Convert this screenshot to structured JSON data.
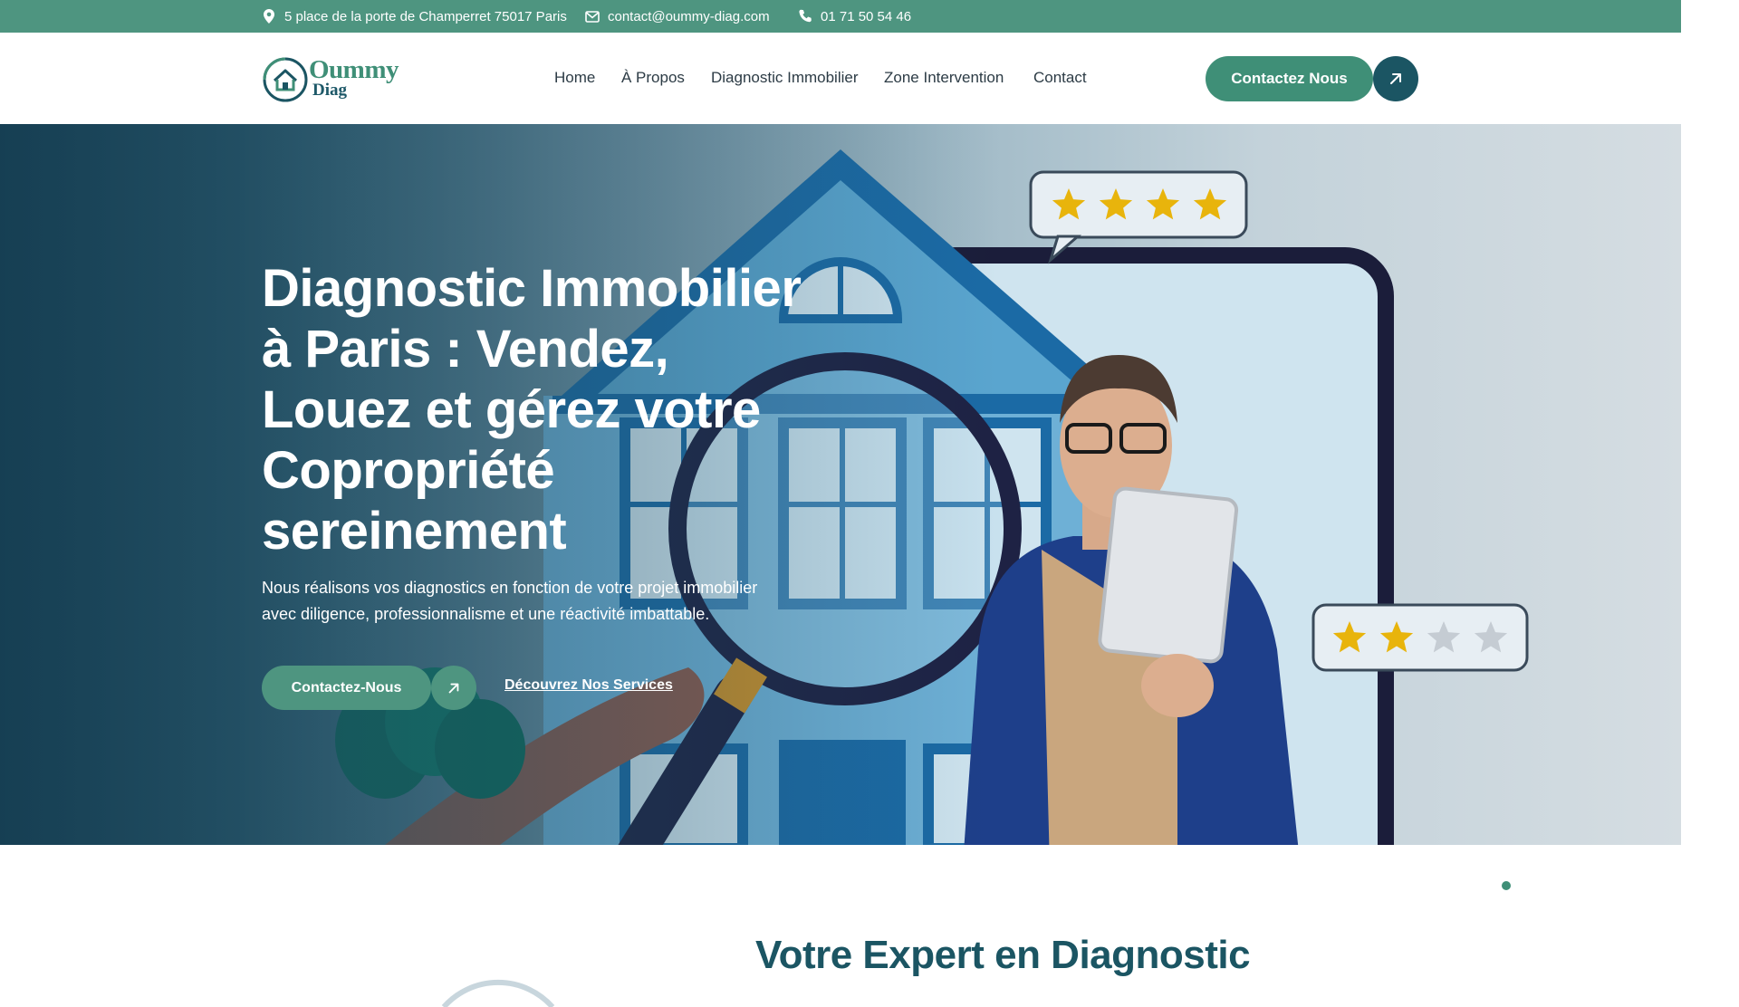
{
  "topbar": {
    "address": "5 place de la porte de Champerret 75017 Paris",
    "email": "contact@oummy-diag.com",
    "phone": "01 71 50 54 46",
    "address_icon": "map-pin-icon",
    "email_icon": "envelope-icon",
    "phone_icon": "phone-icon"
  },
  "header": {
    "logo_line1": "Oummy",
    "logo_line2": "Diag",
    "nav": [
      "Home",
      "À Propos",
      "Diagnostic Immobilier",
      "Zone Intervention",
      "Contact"
    ],
    "cta_label": "Contactez Nous",
    "cta_icon": "arrow-up-right-icon"
  },
  "hero": {
    "title_lines": [
      "Diagnostic Immobilier",
      "à Paris : Vendez,",
      "Louez et gérez votre",
      "Copropriété",
      "sereinement"
    ],
    "subtitle_lines": [
      "Nous réalisons vos diagnostics en fonction de votre projet immobilier",
      "avec diligence, professionnalisme et une réactivité imbattable."
    ],
    "primary_button": "Contactez-Nous",
    "primary_button_icon": "arrow-up-right-icon",
    "secondary_link": "Découvrez Nos Services",
    "rating_top_stars": 4,
    "rating_bottom": {
      "filled": 2,
      "total": 4
    }
  },
  "section": {
    "title": "Votre Expert en Diagnostic"
  },
  "colors": {
    "brand_green": "#4e9580",
    "brand_dark": "#1b5563",
    "text_dark": "#2c3b45",
    "star_gold": "#e8b40c"
  }
}
